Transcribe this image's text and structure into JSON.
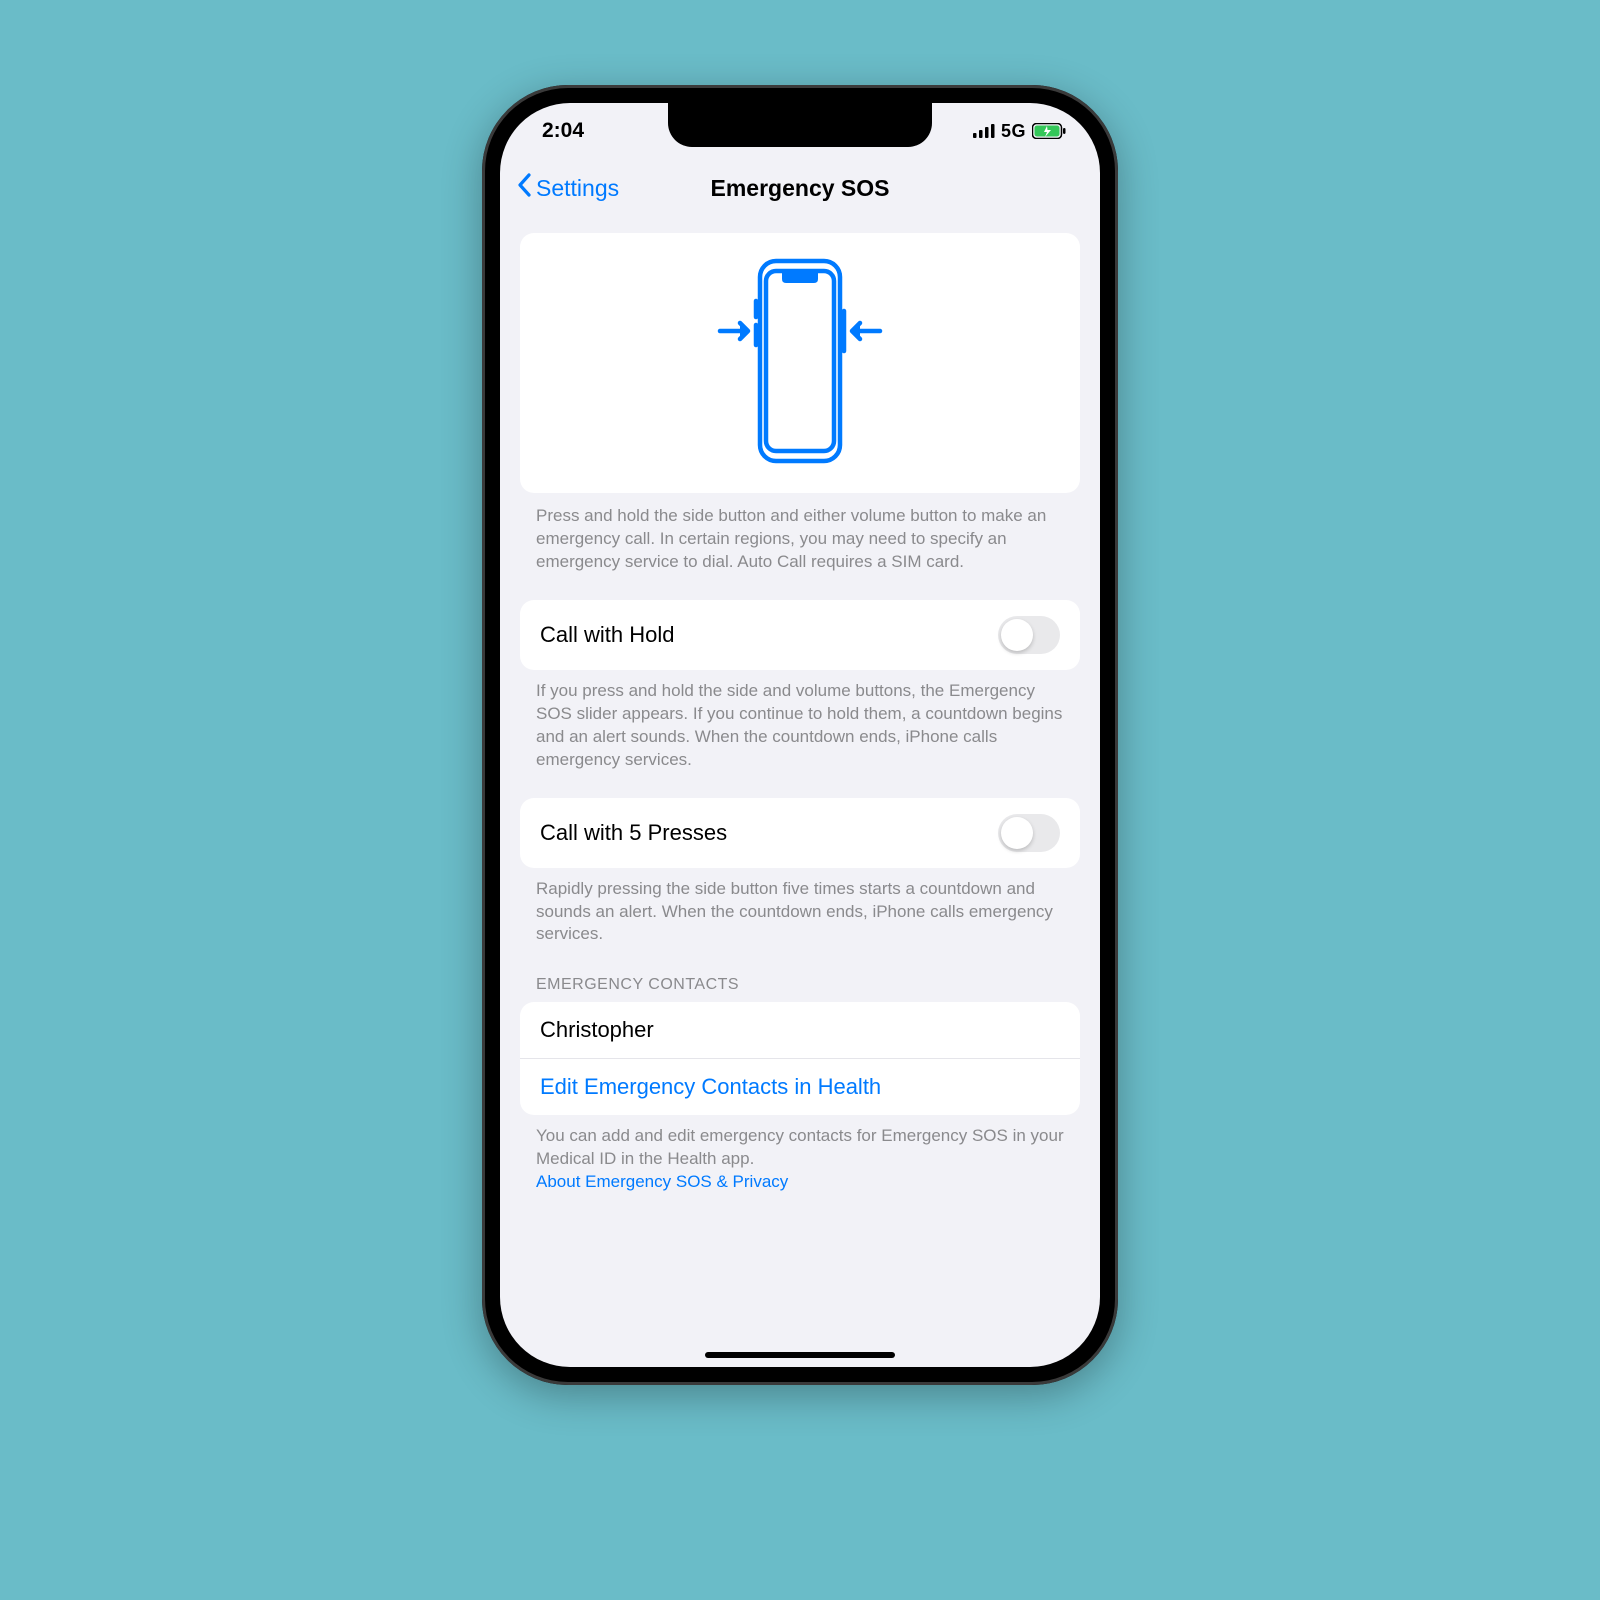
{
  "status": {
    "time": "2:04",
    "network": "5G"
  },
  "nav": {
    "back": "Settings",
    "title": "Emergency SOS"
  },
  "hero_footer": "Press and hold the side button and either volume button to make an emergency call. In certain regions, you may need to specify an emergency service to dial. Auto Call requires a SIM card.",
  "settings": {
    "call_hold": {
      "label": "Call with Hold",
      "on": false,
      "footer": "If you press and hold the side and volume buttons, the Emergency SOS slider appears. If you continue to hold them, a countdown begins and an alert sounds. When the countdown ends, iPhone calls emergency services."
    },
    "call_5": {
      "label": "Call with 5 Presses",
      "on": false,
      "footer": "Rapidly pressing the side button five times starts a countdown and sounds an alert. When the countdown ends, iPhone calls emergency services."
    }
  },
  "contacts": {
    "header": "EMERGENCY CONTACTS",
    "items": [
      "Christopher"
    ],
    "edit_label": "Edit Emergency Contacts in Health",
    "footer": "You can add and edit emergency contacts for Emergency SOS in your Medical ID in the Health app.",
    "privacy_link": "About Emergency SOS & Privacy"
  },
  "colors": {
    "accent": "#007aff"
  }
}
